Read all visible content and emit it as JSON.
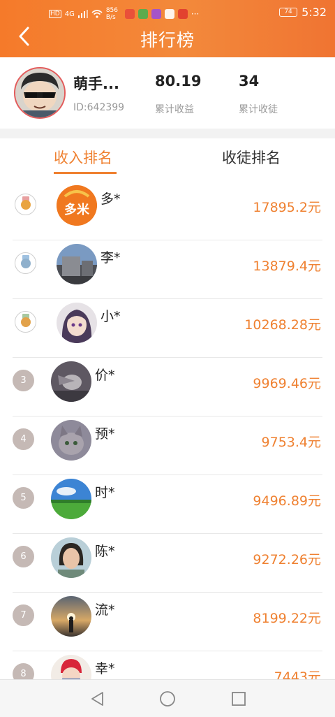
{
  "status_bar": {
    "network": "4G",
    "speed": "856 B/s",
    "battery": "74",
    "time": "5:32"
  },
  "header": {
    "title": "排行榜",
    "back_icon": "chevron-left-icon"
  },
  "profile": {
    "name": "萌手...",
    "id": "ID:642399",
    "stats": [
      {
        "value": "80.19",
        "label": "累计收益"
      },
      {
        "value": "34",
        "label": "累计收徒"
      }
    ]
  },
  "tabs": [
    {
      "label": "收入排名",
      "active": true
    },
    {
      "label": "收徒排名",
      "active": false
    }
  ],
  "ranking": [
    {
      "rank": "",
      "medal": "gold-medal-icon",
      "avatar": "duomi-logo",
      "name": "多*",
      "amount": "17895.2元"
    },
    {
      "rank": "",
      "medal": "silver-medal-icon",
      "avatar": "building-photo",
      "name": "李*",
      "amount": "13879.4元"
    },
    {
      "rank": "",
      "medal": "bronze-medal-icon",
      "avatar": "anime-girl",
      "name": "小*",
      "amount": "10268.28元"
    },
    {
      "rank": "3",
      "medal": "",
      "avatar": "bird-photo",
      "name": "价*",
      "amount": "9969.46元"
    },
    {
      "rank": "4",
      "medal": "",
      "avatar": "cat-photo",
      "name": "预*",
      "amount": "9753.4元"
    },
    {
      "rank": "5",
      "medal": "",
      "avatar": "landscape-photo",
      "name": "时*",
      "amount": "9496.89元"
    },
    {
      "rank": "6",
      "medal": "",
      "avatar": "woman-photo",
      "name": "陈*",
      "amount": "9272.26元"
    },
    {
      "rank": "7",
      "medal": "",
      "avatar": "sunset-silhouette",
      "name": "流*",
      "amount": "8199.22元"
    },
    {
      "rank": "8",
      "medal": "",
      "avatar": "cartoon-kid",
      "name": "幸*",
      "amount": "7443元"
    }
  ],
  "colors": {
    "accent": "#ef8131",
    "header": "#f57a2a",
    "rank_badge": "#c5b9b5"
  }
}
